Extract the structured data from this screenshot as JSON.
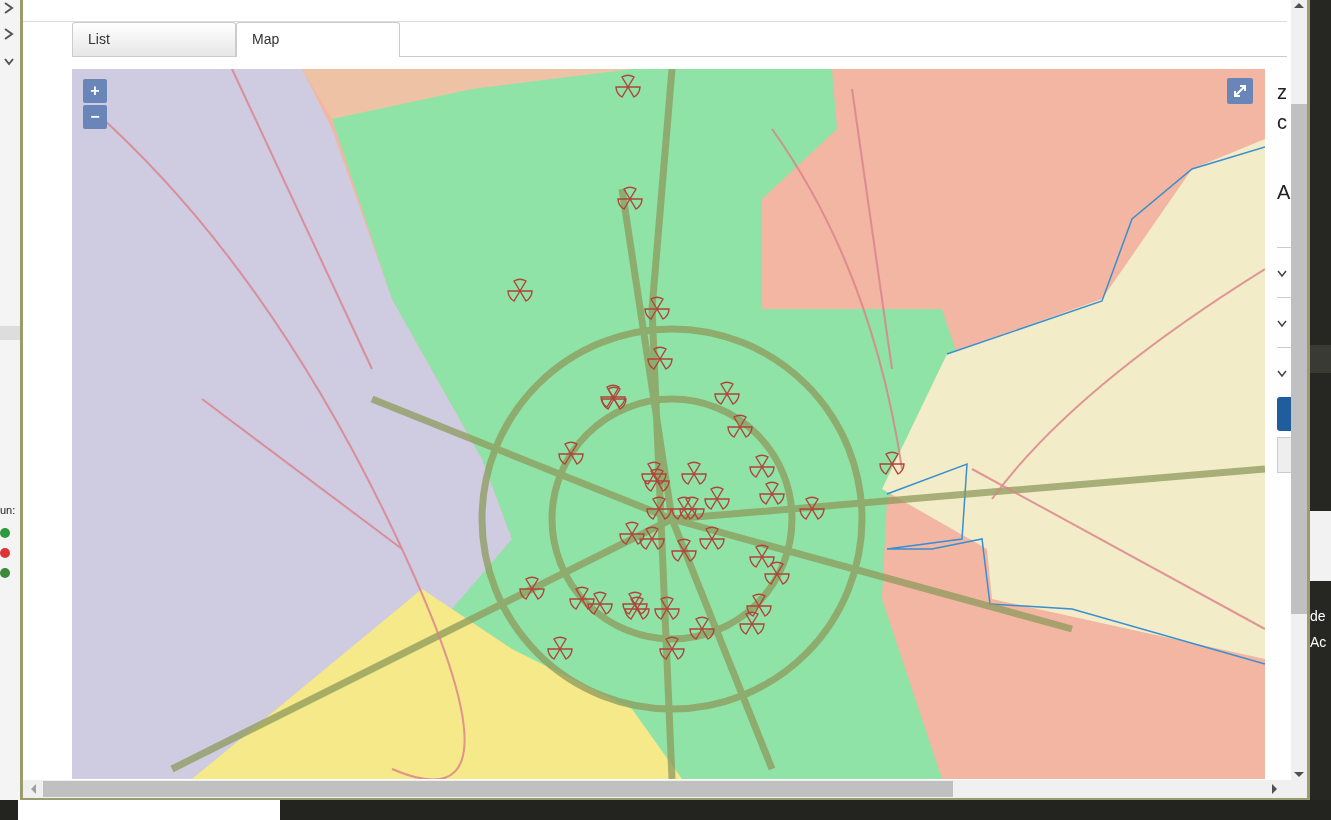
{
  "tabs": [
    {
      "label": "List",
      "selected": false
    },
    {
      "label": "Map",
      "selected": true
    }
  ],
  "map": {
    "zoom_in": "+",
    "zoom_out": "−"
  },
  "side_panel": {
    "fragments": [
      "z",
      "c",
      "A"
    ]
  },
  "background_window": {
    "left_label": "un:",
    "right_texts": [
      "de",
      "Ac"
    ]
  }
}
